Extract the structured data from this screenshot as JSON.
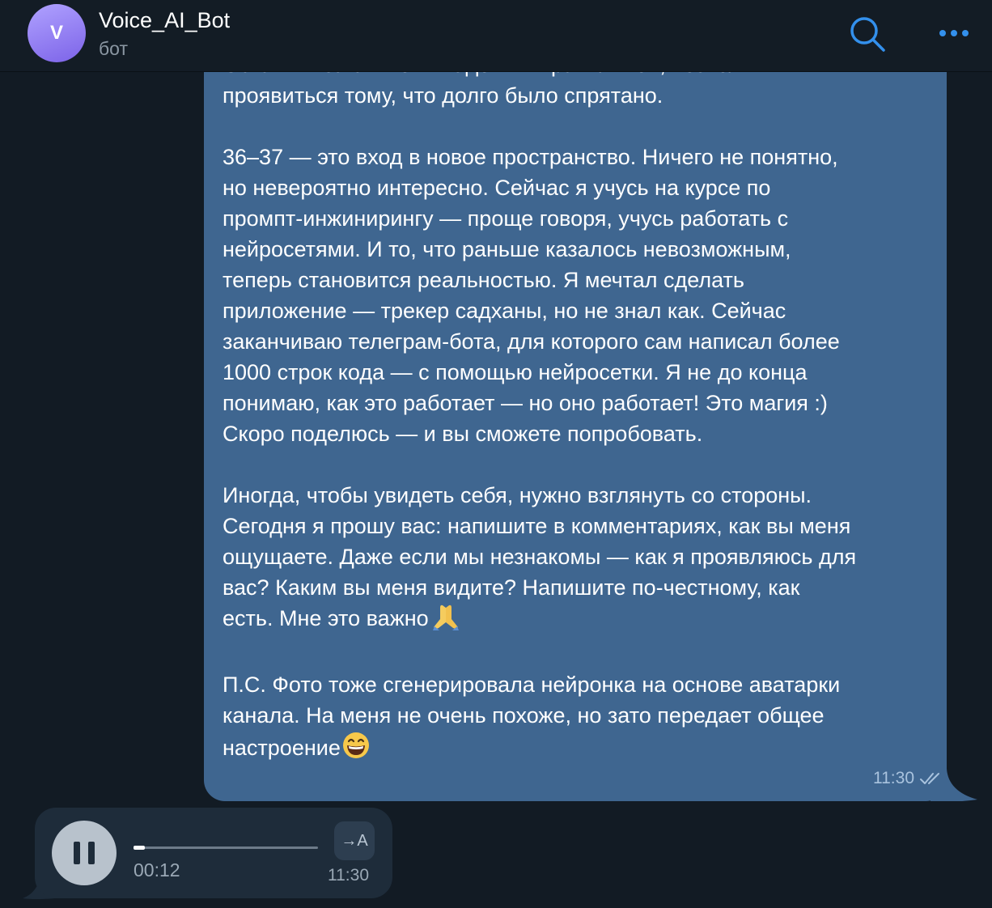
{
  "header": {
    "avatar_letter": "V",
    "title": "Voice_AI_Bot",
    "subtitle": "бот",
    "search_icon": "search-icon",
    "more_icon": "more-dots-icon",
    "accent_color": "#3390ec"
  },
  "message": {
    "paragraphs": [
      "Оставить за спиной «надо» и «правильно», позволить\nпроявиться тому, что долго было спрятано.",
      "36–37 — это вход в новое пространство. Ничего не понятно,\nно невероятно интересно. Сейчас я учусь на курсе по\nпромпт-инжинирингу — проще говоря, учусь работать с\nнейросетями. И то, что раньше казалось невозможным,\nтеперь становится реальностью. Я мечтал сделать\nприложение — трекер садханы, но не знал как. Сейчас\nзаканчиваю телеграм-бота, для которого сам написал более\n1000 строк кода — с помощью нейросетки. Я не до конца\nпонимаю, как это работает — но оно работает! Это магия :)\nСкоро поделюсь — и вы сможете попробовать.",
      "Иногда, чтобы увидеть себя, нужно взглянуть со стороны.\nСегодня я прошу вас: напишите в комментариях, как вы меня\nощущаете. Даже если мы незнакомы — как я проявляюсь для\nвас? Каким вы меня видите? Напишите по-честному, как\nесть. Мне это важно",
      "П.С. Фото тоже сгенерировала нейронка на основе аватарки\nканала. На меня не очень похоже, но зато передает общее\nнастроение"
    ],
    "emoji_praying": "praying-hands-emoji",
    "emoji_grin": "grinning-face-emoji",
    "time": "11:30",
    "status_icon": "double-check-icon",
    "bubble_color": "#3f6690"
  },
  "voice": {
    "duration": "00:12",
    "time": "11:30",
    "transcribe_label": "→A",
    "progress": 0.06,
    "play_state_icon": "pause-icon",
    "bubble_color": "#1e2c3a"
  }
}
